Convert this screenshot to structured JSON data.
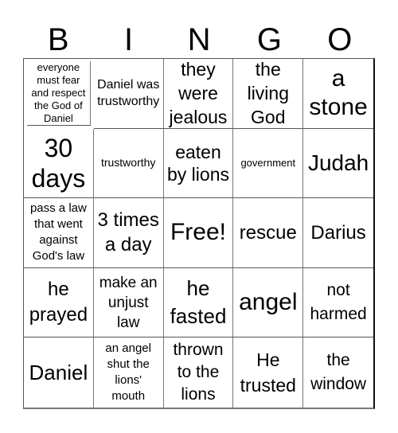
{
  "header": {
    "letters": [
      "B",
      "I",
      "N",
      "G",
      "O"
    ]
  },
  "cells": [
    "everyone must fear and respect the God of Daniel",
    "Daniel was trustworthy",
    "they were jealous",
    "the living God",
    "a stone",
    "30 days",
    "trustworthy",
    "eaten by lions",
    "government",
    "Judah",
    "pass a law that went against God's law",
    "3 times a day",
    "Free!",
    "rescue",
    "Darius",
    "he prayed",
    "make an unjust law",
    "he fasted",
    "angel",
    "not harmed",
    "Daniel",
    "an angel shut the lions' mouth",
    "thrown to the lions",
    "He trusted",
    "the window"
  ]
}
